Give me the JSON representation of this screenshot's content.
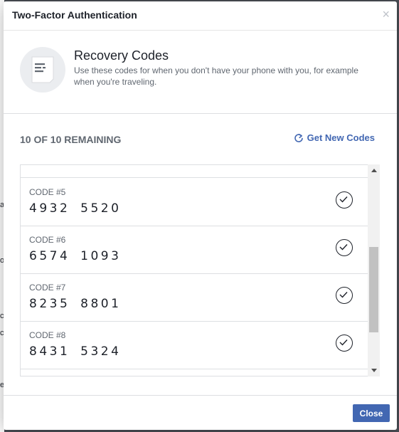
{
  "background": {
    "fragments": [
      "a",
      "o",
      "c",
      "c",
      "e"
    ]
  },
  "dialog": {
    "title": "Two-Factor Authentication",
    "close_glyph": "×",
    "close_icon": "close-icon"
  },
  "intro": {
    "icon": "document-icon",
    "title": "Recovery Codes",
    "description": "Use these codes for when you don't have your phone with you, for example when you're traveling."
  },
  "status": {
    "remaining": "10 OF 10 REMAINING",
    "get_new_label": "Get New Codes",
    "refresh_icon": "refresh-icon"
  },
  "codes": [
    {
      "label": "CODE #5",
      "value": "4932 5520",
      "used": false
    },
    {
      "label": "CODE #6",
      "value": "6574 1093",
      "used": false
    },
    {
      "label": "CODE #7",
      "value": "8235 8801",
      "used": false
    },
    {
      "label": "CODE #8",
      "value": "8431 5324",
      "used": false
    }
  ],
  "footer": {
    "close_label": "Close"
  },
  "colors": {
    "accent": "#4267b2",
    "text": "#1d2129",
    "muted": "#606770",
    "border": "#dddfe2"
  }
}
